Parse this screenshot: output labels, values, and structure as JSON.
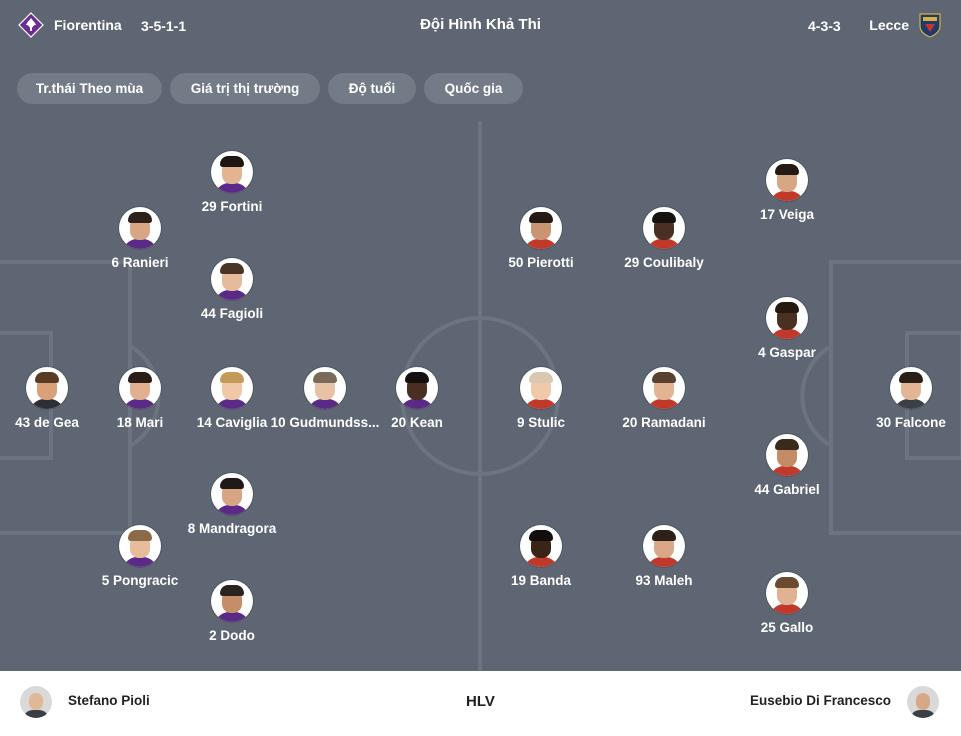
{
  "header": {
    "home_team": "Fiorentina",
    "home_formation": "3-5-1-1",
    "title": "Đội Hình Khả Thi",
    "away_formation": "4-3-3",
    "away_team": "Lecce"
  },
  "filters": [
    "Tr.thái Theo mùa",
    "Giá trị thị trường",
    "Độ tuổi",
    "Quốc gia"
  ],
  "home_players": [
    "43 de Gea",
    "18 Mari",
    "6 Ranieri",
    "5 Pongracic",
    "14 Caviglia",
    "29 Fortini",
    "44 Fagioli",
    "8 Mandragora",
    "2 Dodo",
    "10 Gudmundss...",
    "20 Kean"
  ],
  "away_players": [
    "30 Falcone",
    "17 Veiga",
    "4 Gaspar",
    "44 Gabriel",
    "25 Gallo",
    "29 Coulibaly",
    "20 Ramadani",
    "93 Maleh",
    "50 Pierotti",
    "9 Stulic",
    "19 Banda"
  ],
  "coaches": {
    "home": "Stefano Pioli",
    "label": "HLV",
    "away": "Eusebio Di Francesco"
  },
  "colors": {
    "pitch": "#5d6672",
    "chip": "#727b86",
    "home_accent": "#6a2c91",
    "away_accent": "#1f3a6e",
    "away_gold": "#d8b23a"
  },
  "icons": {
    "home_logo": "fiorentina-crest-icon",
    "away_logo": "lecce-crest-icon"
  }
}
